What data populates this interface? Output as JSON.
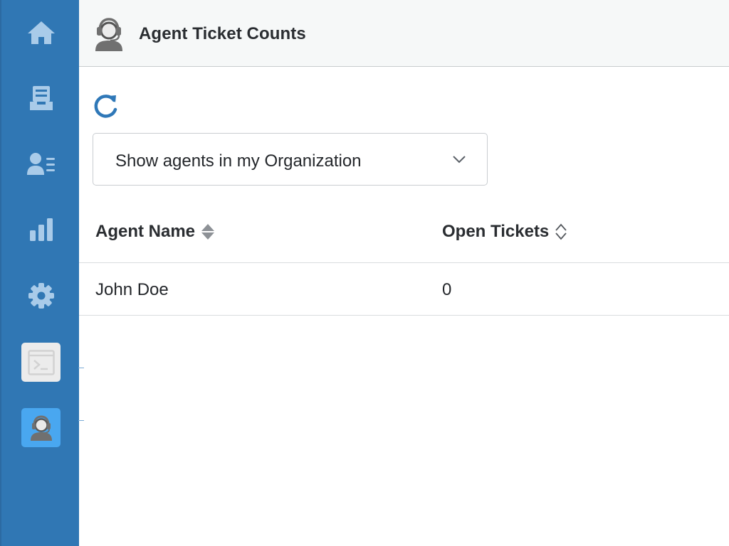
{
  "sidebar": {
    "items": [
      {
        "id": "home",
        "icon": "home-icon"
      },
      {
        "id": "inbox",
        "icon": "inbox-tray-icon"
      },
      {
        "id": "contacts",
        "icon": "contact-list-icon"
      },
      {
        "id": "reports",
        "icon": "bar-chart-icon"
      },
      {
        "id": "settings",
        "icon": "gear-icon"
      }
    ],
    "apps": [
      {
        "id": "console",
        "icon": "terminal-icon"
      },
      {
        "id": "agent-ticket-counts",
        "icon": "agent-headset-icon",
        "active": true
      }
    ],
    "colors": {
      "background": "#3077b4",
      "icon": "#a9cbe9",
      "active_tile": "#49a7f0"
    }
  },
  "header": {
    "title": "Agent Ticket Counts",
    "icon": "agent-headset-icon"
  },
  "toolbar": {
    "refresh_icon": "refresh-icon",
    "refresh_color": "#2f78b8"
  },
  "filter": {
    "selected": "Show agents in my Organization",
    "icon": "chevron-down-icon"
  },
  "table": {
    "columns": [
      {
        "label": "Agent Name",
        "sort": "sorted"
      },
      {
        "label": "Open Tickets",
        "sort": "unsorted"
      }
    ],
    "rows": [
      {
        "agent_name": "John Doe",
        "open_tickets": "0"
      }
    ]
  }
}
